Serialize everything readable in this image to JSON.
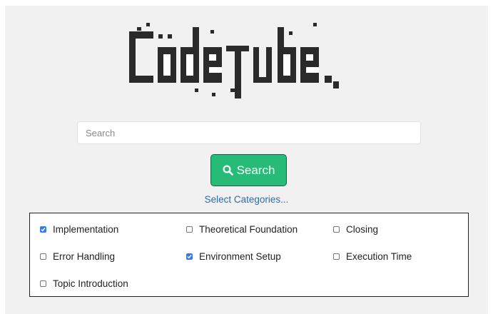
{
  "logo": {
    "text": "Codetube"
  },
  "search": {
    "placeholder": "Search",
    "value": ""
  },
  "search_button": {
    "label": "Search"
  },
  "select_categories": {
    "label": "Select Categories..."
  },
  "categories": [
    {
      "label": "Implementation",
      "checked": true
    },
    {
      "label": "Theoretical Foundation",
      "checked": false
    },
    {
      "label": "Closing",
      "checked": false
    },
    {
      "label": "Error Handling",
      "checked": false
    },
    {
      "label": "Environment Setup",
      "checked": true
    },
    {
      "label": "Execution Time",
      "checked": false
    },
    {
      "label": "Topic Introduction",
      "checked": false
    }
  ],
  "colors": {
    "button_bg": "#26bc78",
    "link": "#2b6cb0",
    "checkbox_checked": "#2f7cf6",
    "panel_bg": "#f1f1f1"
  },
  "icons": {
    "search_button_icon": "magnifier-icon"
  }
}
